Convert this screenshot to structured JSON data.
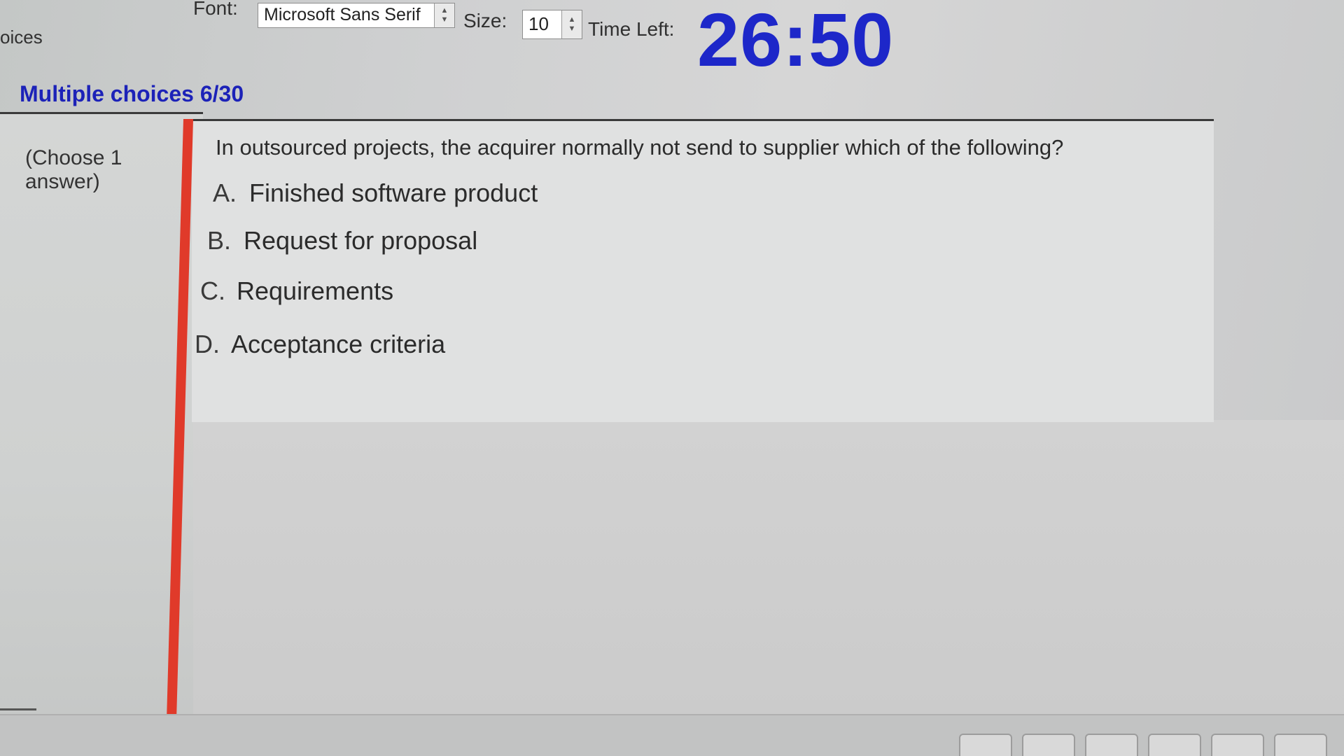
{
  "toolbar": {
    "tab_fragment": "oices",
    "font_label": "Font:",
    "font_value": "Microsoft Sans Serif",
    "size_label": "Size:",
    "size_value": "10",
    "time_left_label": "Time Left:",
    "timer": "26:50"
  },
  "section": {
    "title": "Multiple choices 6/30"
  },
  "sidebar": {
    "hint": "(Choose 1 answer)"
  },
  "question": {
    "text": "In outsourced projects, the acquirer normally not send to supplier which of the following?",
    "options": [
      {
        "letter": "A.",
        "label": "Finished software product"
      },
      {
        "letter": "B.",
        "label": "Request for proposal"
      },
      {
        "letter": "C.",
        "label": "Requirements"
      },
      {
        "letter": "D.",
        "label": "Acceptance criteria"
      }
    ]
  },
  "colors": {
    "timer": "#1d27c9",
    "title": "#1c22b8",
    "accent_bar": "#e03a2a"
  }
}
